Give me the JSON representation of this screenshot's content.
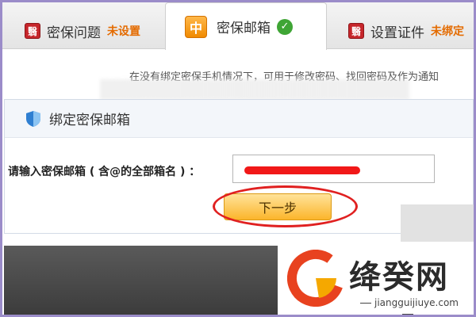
{
  "tabs": [
    {
      "icon": "seal-icon",
      "icon_glyph": "翳",
      "label": "密保问题",
      "status": "未设置"
    },
    {
      "icon": "box-icon",
      "icon_glyph": "中",
      "label": "密保邮箱",
      "status_icon": "check-icon"
    },
    {
      "icon": "seal-icon",
      "icon_glyph": "翳",
      "label": "设置证件",
      "status": "未绑定"
    }
  ],
  "description": "在没有绑定密保手机情况下，可用于修改密码、找回密码及作为通知",
  "panel": {
    "title": "绑定密保邮箱",
    "field_label": "请输入密保邮箱 ( 含@的全部箱名 ) ：",
    "email_value": "",
    "next_label": "下一步"
  },
  "watermark": {
    "brand": "绛癸网",
    "url": "jiangguijiuye.com"
  },
  "colors": {
    "accent_orange": "#e46b00",
    "button": "#fbb52b",
    "annotation_red": "#e02020",
    "frame": "#9b8cc9"
  }
}
